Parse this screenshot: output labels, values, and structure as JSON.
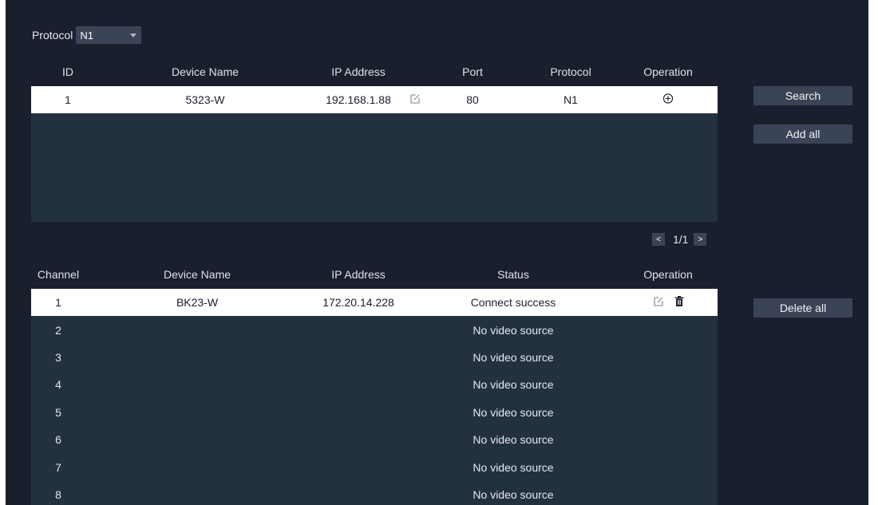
{
  "top_filter": {
    "protocol_label": "Protocol",
    "protocol_value": "N1"
  },
  "search_table": {
    "headers": [
      "ID",
      "Device Name",
      "IP Address",
      "Port",
      "Protocol",
      "Operation"
    ],
    "rows": [
      {
        "id": "1",
        "device_name": "5323-W",
        "ip": "192.168.1.88",
        "port": "80",
        "protocol": "N1"
      }
    ]
  },
  "buttons": {
    "search": "Search",
    "add_all": "Add all",
    "delete_all": "Delete all"
  },
  "pager": {
    "prev": "<",
    "page": "1/1",
    "next": ">"
  },
  "channel_table": {
    "headers": [
      "Channel",
      "Device Name",
      "IP Address",
      "Status",
      "Operation"
    ],
    "rows": [
      {
        "channel": "1",
        "device_name": "BK23-W",
        "ip": "172.20.14.228",
        "status": "Connect success"
      },
      {
        "channel": "2",
        "device_name": "",
        "ip": "",
        "status": "No video source"
      },
      {
        "channel": "3",
        "device_name": "",
        "ip": "",
        "status": "No video source"
      },
      {
        "channel": "4",
        "device_name": "",
        "ip": "",
        "status": "No video source"
      },
      {
        "channel": "5",
        "device_name": "",
        "ip": "",
        "status": "No video source"
      },
      {
        "channel": "6",
        "device_name": "",
        "ip": "",
        "status": "No video source"
      },
      {
        "channel": "7",
        "device_name": "",
        "ip": "",
        "status": "No video source"
      },
      {
        "channel": "8",
        "device_name": "",
        "ip": "",
        "status": "No video source"
      }
    ]
  },
  "colors": {
    "background": "#1a1f2e",
    "table_body": "#233040",
    "button": "#3b4456",
    "selected_row": "#ffffff"
  }
}
